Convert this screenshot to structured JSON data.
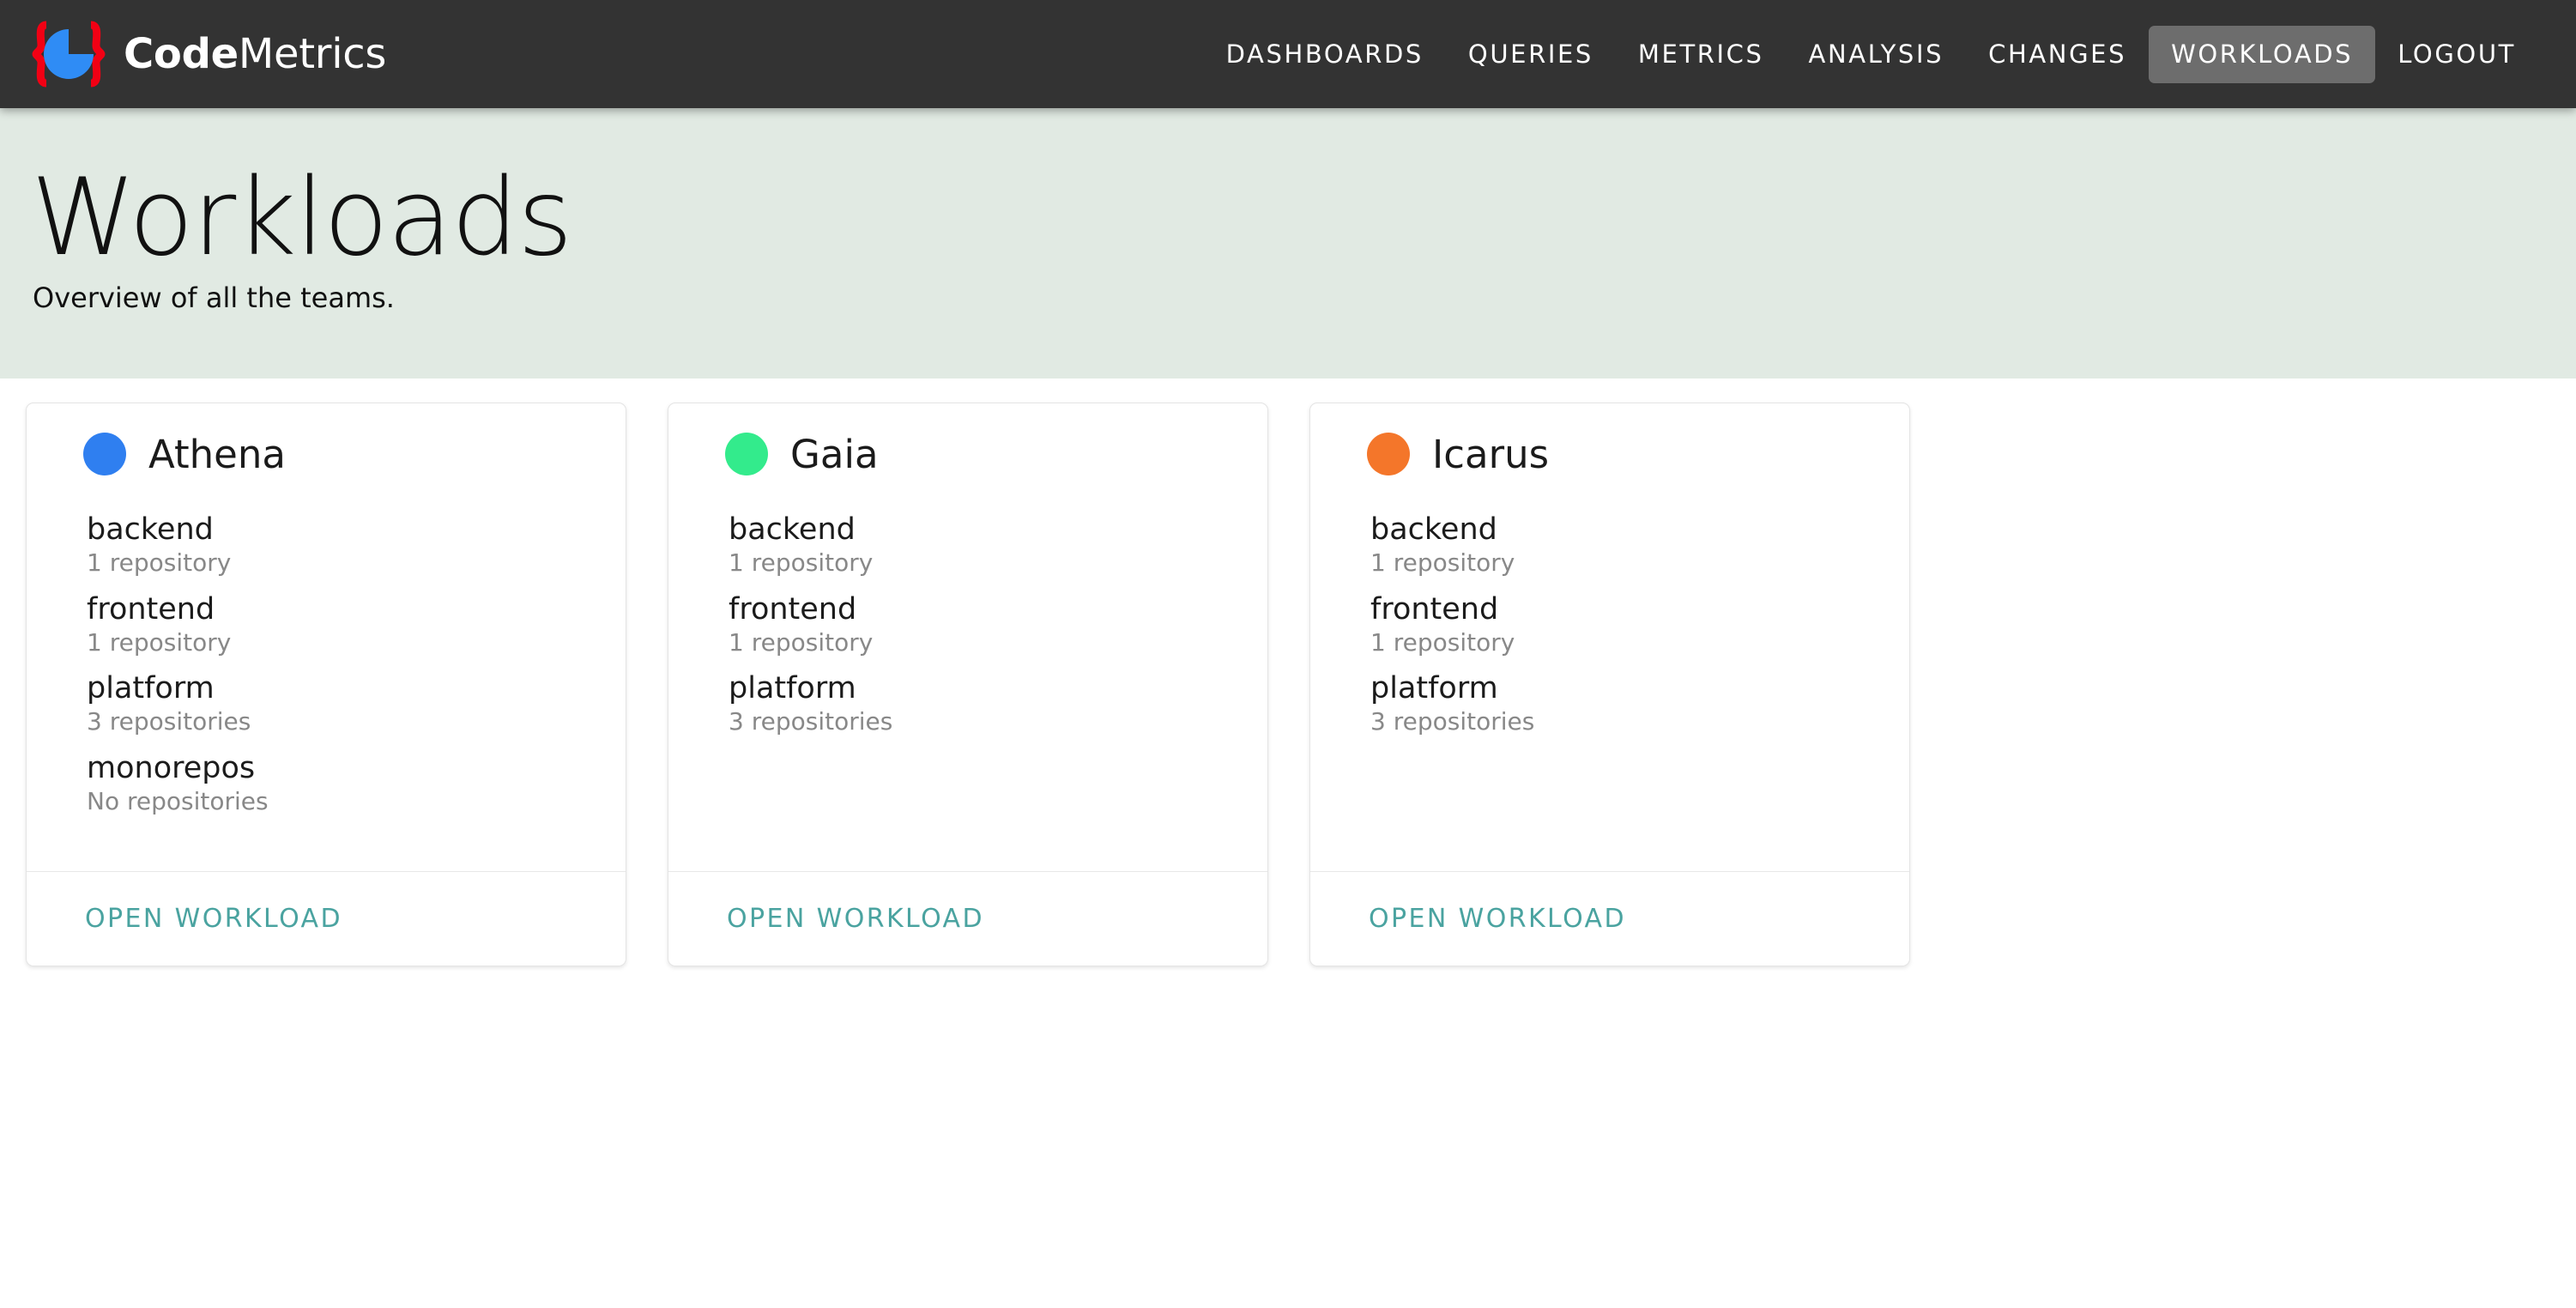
{
  "brand": {
    "name_bold": "Code",
    "name_light": "Metrics",
    "logo_icon": "pie-chart-braces-logo",
    "logo_pie_color": "#2f8cf5",
    "logo_brace_color": "#f20014"
  },
  "nav": {
    "items": [
      {
        "label": "DASHBOARDS",
        "active": false
      },
      {
        "label": "QUERIES",
        "active": false
      },
      {
        "label": "METRICS",
        "active": false
      },
      {
        "label": "ANALYSIS",
        "active": false
      },
      {
        "label": "CHANGES",
        "active": false
      },
      {
        "label": "WORKLOADS",
        "active": true
      },
      {
        "label": "LOGOUT",
        "active": false
      }
    ],
    "active_bg": "#6d6d6d",
    "bar_bg": "#333333"
  },
  "hero": {
    "title": "Workloads",
    "subtitle": "Overview of all the teams.",
    "bg_color": "#e1eae3"
  },
  "cards": [
    {
      "team": "Athena",
      "dot_color": "#2f7ff0",
      "repos": [
        {
          "label": "backend",
          "count": "1 repository"
        },
        {
          "label": "frontend",
          "count": "1 repository"
        },
        {
          "label": "platform",
          "count": "3 repositories"
        },
        {
          "label": "monorepos",
          "count": "No repositories"
        }
      ],
      "action": "OPEN WORKLOAD"
    },
    {
      "team": "Gaia",
      "dot_color": "#33eb8c",
      "repos": [
        {
          "label": "backend",
          "count": "1 repository"
        },
        {
          "label": "frontend",
          "count": "1 repository"
        },
        {
          "label": "platform",
          "count": "3 repositories"
        }
      ],
      "action": "OPEN WORKLOAD"
    },
    {
      "team": "Icarus",
      "dot_color": "#f4762a",
      "repos": [
        {
          "label": "backend",
          "count": "1 repository"
        },
        {
          "label": "frontend",
          "count": "1 repository"
        },
        {
          "label": "platform",
          "count": "3 repositories"
        }
      ],
      "action": "OPEN WORKLOAD"
    }
  ],
  "colors": {
    "link_teal": "#4aa3a0",
    "card_border": "#e4e4e4",
    "muted_text": "#888888"
  }
}
